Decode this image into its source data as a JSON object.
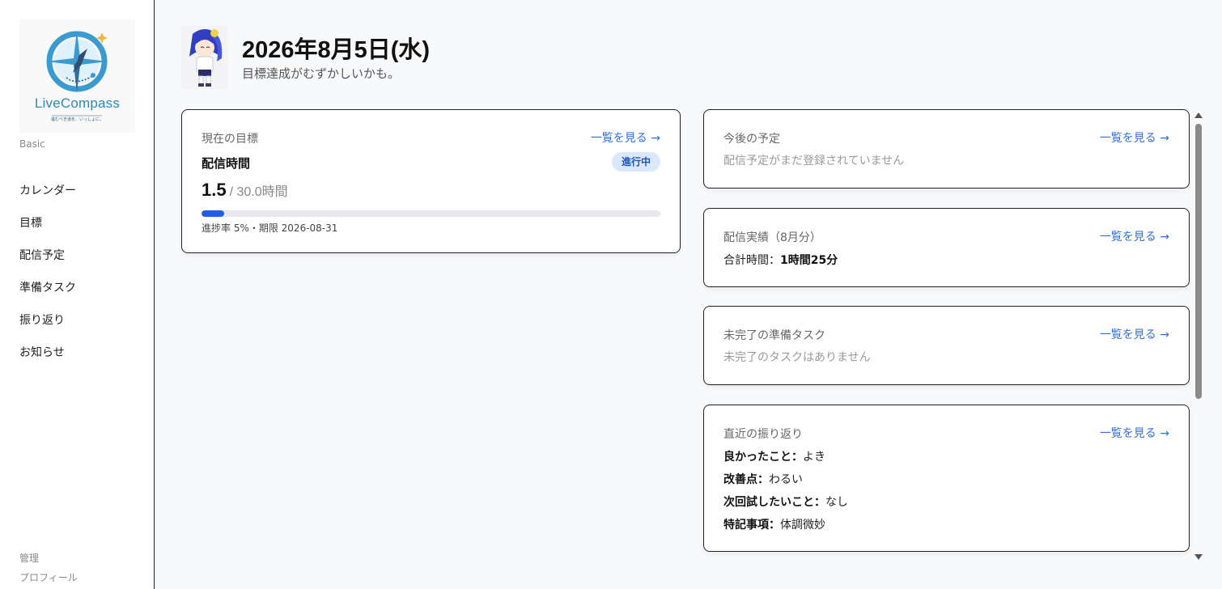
{
  "sidebar": {
    "logo_text": "LiveCompass",
    "logo_tagline": "進むべき道を、いっしょに。",
    "plan": "Basic",
    "nav": [
      {
        "label": "カレンダー"
      },
      {
        "label": "目標"
      },
      {
        "label": "配信予定"
      },
      {
        "label": "準備タスク"
      },
      {
        "label": "振り返り"
      },
      {
        "label": "お知らせ"
      }
    ],
    "footer": {
      "admin": "管理",
      "profile": "プロフィール"
    }
  },
  "header": {
    "date": "2026年8月5日(水)",
    "message": "目標達成がむずかしいかも。"
  },
  "goal_card": {
    "title": "現在の目標",
    "link": "一覧を見る →",
    "goal_name": "配信時間",
    "status": "進行中",
    "current": "1.5",
    "target": "/ 30.0時間",
    "progress_fraction": 0.05,
    "meta": "進捗率 5%・期限 2026-08-31"
  },
  "schedule_card": {
    "title": "今後の予定",
    "link": "一覧を見る →",
    "empty": "配信予定がまだ登録されていません"
  },
  "results_card": {
    "title": "配信実績（8月分）",
    "link": "一覧を見る →",
    "total_label": "合計時間：",
    "total_value": "1時間25分"
  },
  "tasks_card": {
    "title": "未完了の準備タスク",
    "link": "一覧を見る →",
    "empty": "未完了のタスクはありません"
  },
  "review_card": {
    "title": "直近の振り返り",
    "link": "一覧を見る →",
    "items": [
      {
        "label": "良かったこと：",
        "value": "よき"
      },
      {
        "label": "改善点：",
        "value": "わるい"
      },
      {
        "label": "次回試したいこと：",
        "value": "なし"
      },
      {
        "label": "特記事項：",
        "value": "体調微妙"
      }
    ]
  },
  "colors": {
    "accent": "#2f6fde",
    "progress": "#1f5fe8",
    "badge_bg": "#dbe8fb"
  }
}
